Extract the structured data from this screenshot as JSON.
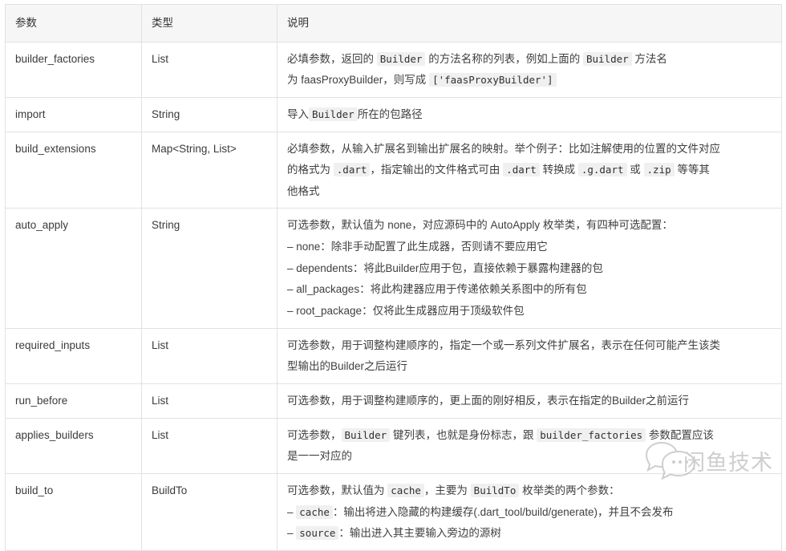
{
  "table": {
    "headers": [
      "参数",
      "类型",
      "说明"
    ],
    "rows": [
      {
        "name": "builder_factories",
        "type": "List",
        "desc_lines": [
          [
            {
              "t": "text",
              "v": "必填参数，返回的 "
            },
            {
              "t": "code",
              "v": "Builder"
            },
            {
              "t": "text",
              "v": " 的方法名称的列表，例如上面的 "
            },
            {
              "t": "code",
              "v": "Builder"
            },
            {
              "t": "text",
              "v": " 方法名"
            }
          ],
          [
            {
              "t": "text",
              "v": "为 faasProxyBuilder，则写成 "
            },
            {
              "t": "code",
              "v": "['faasProxyBuilder']"
            }
          ]
        ]
      },
      {
        "name": "import",
        "type": "String",
        "desc_lines": [
          [
            {
              "t": "text",
              "v": "导入"
            },
            {
              "t": "code",
              "v": "Builder"
            },
            {
              "t": "text",
              "v": "所在的包路径"
            }
          ]
        ]
      },
      {
        "name": "build_extensions",
        "type": "Map<String, List>",
        "desc_lines": [
          [
            {
              "t": "text",
              "v": "必填参数，从输入扩展名到输出扩展名的映射。举个例子：比如注解使用的位置的文件对应"
            }
          ],
          [
            {
              "t": "text",
              "v": "的格式为 "
            },
            {
              "t": "code",
              "v": ".dart"
            },
            {
              "t": "text",
              "v": "，指定输出的文件格式可由 "
            },
            {
              "t": "code",
              "v": ".dart"
            },
            {
              "t": "text",
              "v": " 转换成 "
            },
            {
              "t": "code",
              "v": ".g.dart"
            },
            {
              "t": "text",
              "v": " 或 "
            },
            {
              "t": "code",
              "v": ".zip"
            },
            {
              "t": "text",
              "v": " 等等其"
            }
          ],
          [
            {
              "t": "text",
              "v": "他格式"
            }
          ]
        ]
      },
      {
        "name": "auto_apply",
        "type": "String",
        "desc_lines": [
          [
            {
              "t": "text",
              "v": "可选参数，默认值为 none，对应源码中的 AutoApply 枚举类，有四种可选配置："
            }
          ],
          [
            {
              "t": "text",
              "v": "– none：除非手动配置了此生成器，否则请不要应用它"
            }
          ],
          [
            {
              "t": "text",
              "v": "– dependents：将此Builder应用于包，直接依赖于暴露构建器的包"
            }
          ],
          [
            {
              "t": "text",
              "v": "– all_packages：将此构建器应用于传递依赖关系图中的所有包"
            }
          ],
          [
            {
              "t": "text",
              "v": "– root_package：仅将此生成器应用于顶级软件包"
            }
          ]
        ]
      },
      {
        "name": "required_inputs",
        "type": "List",
        "desc_lines": [
          [
            {
              "t": "text",
              "v": "可选参数，用于调整构建顺序的，指定一个或一系列文件扩展名，表示在任何可能产生该类"
            }
          ],
          [
            {
              "t": "text",
              "v": "型输出的Builder之后运行"
            }
          ]
        ]
      },
      {
        "name": "run_before",
        "type": "List",
        "desc_lines": [
          [
            {
              "t": "text",
              "v": "可选参数，用于调整构建顺序的，更上面的刚好相反，表示在指定的Builder之前运行"
            }
          ]
        ]
      },
      {
        "name": "applies_builders",
        "type": "List",
        "desc_lines": [
          [
            {
              "t": "text",
              "v": "可选参数，"
            },
            {
              "t": "code",
              "v": "Builder"
            },
            {
              "t": "text",
              "v": " 键列表，也就是身份标志，跟 "
            },
            {
              "t": "code",
              "v": "builder_factories"
            },
            {
              "t": "text",
              "v": " 参数配置应该"
            }
          ],
          [
            {
              "t": "text",
              "v": "是一一对应的"
            }
          ]
        ]
      },
      {
        "name": "build_to",
        "type": "BuildTo",
        "desc_lines": [
          [
            {
              "t": "text",
              "v": "可选参数，默认值为 "
            },
            {
              "t": "code",
              "v": "cache"
            },
            {
              "t": "text",
              "v": "，主要为 "
            },
            {
              "t": "code",
              "v": "BuildTo"
            },
            {
              "t": "text",
              "v": " 枚举类的两个参数："
            }
          ],
          [
            {
              "t": "text",
              "v": "– "
            },
            {
              "t": "code",
              "v": "cache"
            },
            {
              "t": "text",
              "v": "：输出将进入隐藏的构建缓存(.dart_tool/build/generate)，并且不会发布"
            }
          ],
          [
            {
              "t": "text",
              "v": "– "
            },
            {
              "t": "code",
              "v": "source"
            },
            {
              "t": "text",
              "v": "：输出进入其主要输入旁边的源树"
            }
          ]
        ]
      }
    ]
  },
  "watermark": {
    "label": "闲鱼技术",
    "color": "#9a9a9a"
  }
}
